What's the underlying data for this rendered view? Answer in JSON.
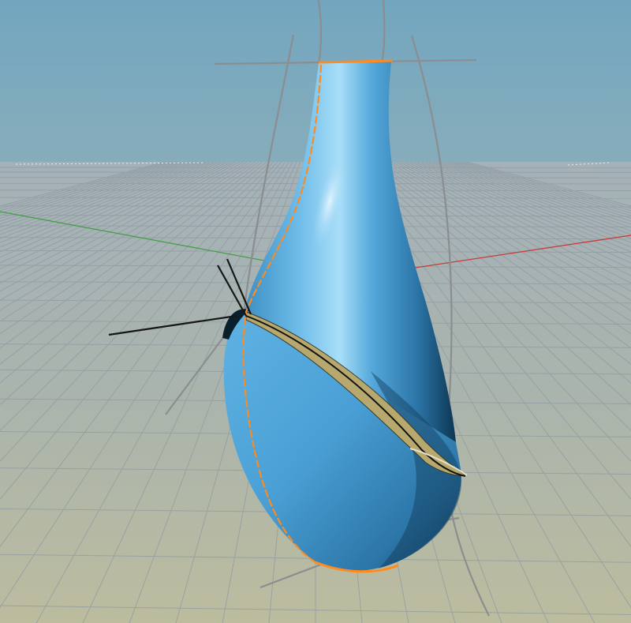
{
  "scene": {
    "object": "vase-nurbs-surface",
    "colors": {
      "sky_top": "#77a8bf",
      "sky_bottom": "#82aab8",
      "ground_far": "#9aa9b3",
      "ground_near": "#b8b9a2",
      "grid_line": "#8d98a0",
      "grid_major": "#7f8a92",
      "axis_x": "#c0393b",
      "axis_y": "#3fa34d",
      "surface_light": "#7cc6ef",
      "surface_mid": "#4ba2d6",
      "surface_dark": "#1e5f8c",
      "surface_shadow": "#0c2f4a",
      "edge_highlight": "#ff8a1f",
      "construction_curve": "#8a8d90",
      "cut_band": "#b8a86a",
      "control_line": "#1a1a1a"
    },
    "icons": [
      "vase-surface",
      "isocurve",
      "seam-curve",
      "ground-grid",
      "world-axes"
    ]
  }
}
